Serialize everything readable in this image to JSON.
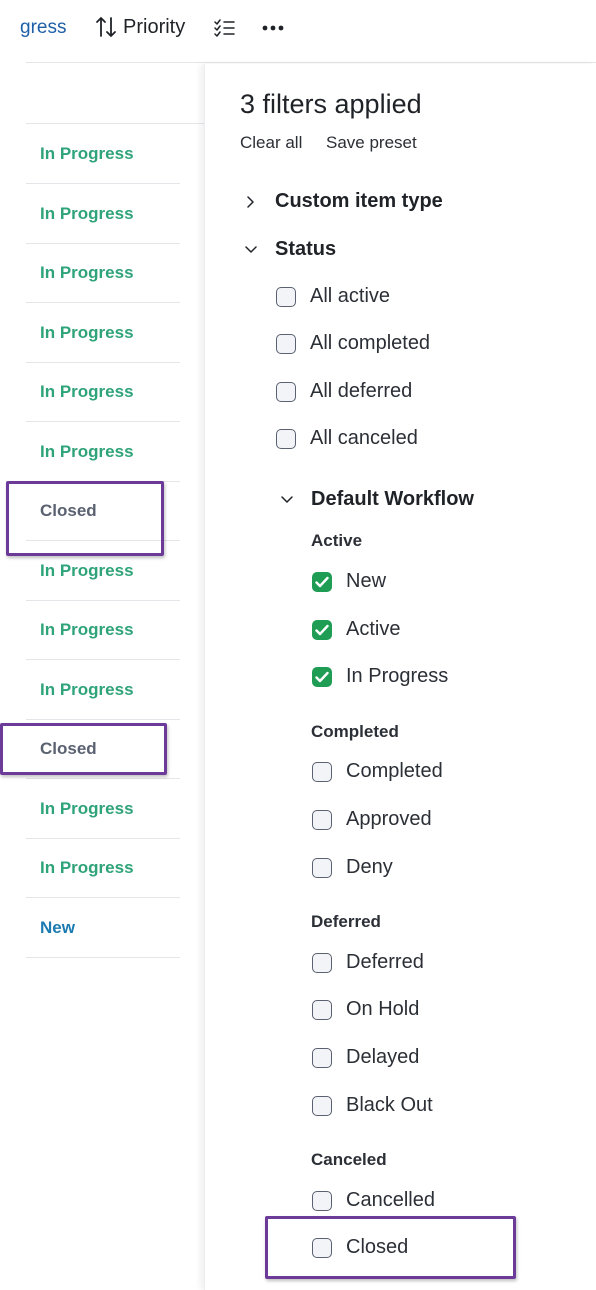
{
  "toolbar": {
    "progress_text": "gress",
    "sort_icon": "sort-arrows-icon",
    "priority_label": "Priority",
    "checklist_icon": "checklist-icon",
    "more_icon": "more-icon"
  },
  "list": {
    "rows": [
      "In Progress",
      "In Progress",
      "In Progress",
      "In Progress",
      "In Progress",
      "In Progress",
      "Closed",
      "In Progress",
      "In Progress",
      "In Progress",
      "Closed",
      "In Progress",
      "In Progress",
      "New"
    ]
  },
  "colors": {
    "in_progress": "#2fa37a",
    "closed": "#5a6170",
    "new": "#1c7bb0",
    "highlight": "#6c3a99",
    "checked": "#1f9d55"
  },
  "filters": {
    "title": "3 filters applied",
    "clear_all": "Clear all",
    "save_preset": "Save preset",
    "custom_item_type": "Custom item type",
    "status": "Status",
    "all_options": [
      "All active",
      "All completed",
      "All deferred",
      "All canceled"
    ],
    "workflow": {
      "name": "Default Workflow",
      "active_label": "Active",
      "active_items": [
        "New",
        "Active",
        "In Progress"
      ],
      "completed_label": "Completed",
      "completed_items": [
        "Completed",
        "Approved",
        "Deny"
      ],
      "deferred_label": "Deferred",
      "deferred_items": [
        "Deferred",
        "On Hold",
        "Delayed",
        "Black Out"
      ],
      "canceled_label": "Canceled",
      "canceled_items": [
        "Cancelled",
        "Closed"
      ]
    }
  }
}
